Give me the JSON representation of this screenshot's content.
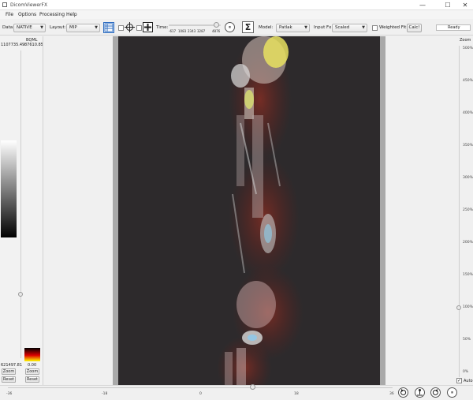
{
  "window": {
    "title": "DicomViewerFX",
    "minimize": "—",
    "maximize": "☐",
    "close": "✕"
  },
  "menu": [
    "File",
    "Options",
    "Processing",
    "Help"
  ],
  "toolbar": {
    "data_label": "Data:",
    "data_value": "NATIVE",
    "layout_label": "Layout:",
    "layout_value": "MIP",
    "time_label": "Time:",
    "time_ticks": [
      "-617",
      "1083",
      "2343",
      "3287",
      "4876"
    ],
    "pause": "⏸",
    "sigma": "Σ",
    "model_label": "Model:",
    "model_value": "Patlak",
    "input_label": "Input Fx",
    "input_value": "Scaled",
    "weighted_label": "Weighted Fit",
    "calc_label": "Calc!",
    "status": "Ready"
  },
  "left_panel": {
    "max_value": "1107735.49",
    "bqml_label": "BQML",
    "bqml_value": "87610.85",
    "min_value": "621497.81",
    "hot_min": "0.00",
    "zoom1": "Zoom",
    "reset1": "Reset",
    "zoom2": "Zoom",
    "reset2": "Reset"
  },
  "right_panel": {
    "zoom_label": "Zoom",
    "ticks": [
      "500%",
      "450%",
      "400%",
      "350%",
      "300%",
      "250%",
      "200%",
      "150%",
      "100%",
      "50%",
      "0%"
    ],
    "auto_label": "Auto",
    "zoom_level_pct": 100
  },
  "bottom": {
    "ticks": [
      "-36",
      "-18",
      "0",
      "18",
      "36"
    ],
    "rotation_value": 0
  },
  "colors": {
    "accent": "#2d6cc0",
    "image_bg": "#2d2a2c"
  }
}
